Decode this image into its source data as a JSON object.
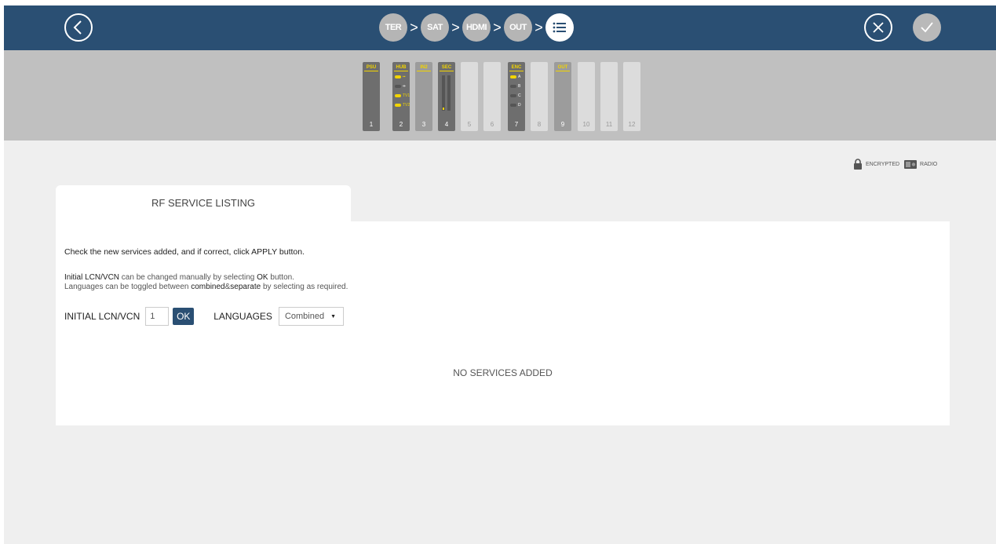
{
  "header": {
    "steps": [
      {
        "label": "TER",
        "active": false
      },
      {
        "label": "SAT",
        "active": false
      },
      {
        "label": "HDMI",
        "active": false
      },
      {
        "label": "OUT",
        "active": false
      },
      {
        "label": "",
        "icon": "list-icon",
        "active": true
      }
    ],
    "step_separator": ">"
  },
  "rack": {
    "slots": [
      {
        "number": "1",
        "tag": "PSU"
      },
      {
        "number": "2",
        "tag": "HUB",
        "ports": [
          "",
          "",
          "TV1",
          "TV2"
        ]
      },
      {
        "number": "3",
        "tag": "IN2"
      },
      {
        "number": "4",
        "tag": "SEC"
      },
      {
        "number": "5",
        "tag": ""
      },
      {
        "number": "6",
        "tag": ""
      },
      {
        "number": "7",
        "tag": "ENC",
        "ports": [
          "A",
          "B",
          "C",
          "D"
        ]
      },
      {
        "number": "8",
        "tag": ""
      },
      {
        "number": "9",
        "tag": "OUT"
      },
      {
        "number": "10",
        "tag": ""
      },
      {
        "number": "11",
        "tag": ""
      },
      {
        "number": "12",
        "tag": ""
      }
    ]
  },
  "legend": {
    "encrypted_label": "ENCRYPTED",
    "radio_label": "RADIO"
  },
  "tab": {
    "label": "RF SERVICE LISTING"
  },
  "panel": {
    "instruction": "Check the new services added, and if correct, click APPLY button.",
    "note1": {
      "prefix": "Initial LCN/VCN",
      "middle": " can be changed manually by selecting ",
      "button_word": "OK",
      "suffix": " button."
    },
    "note2": {
      "prefix": "Languages can be toggled between ",
      "word1": "combined",
      "amp": "&",
      "word2": "separate",
      "suffix": " by selecting as required."
    },
    "lcn_label": "INITIAL LCN/VCN",
    "lcn_value": "1",
    "ok_label": "OK",
    "languages_label": "LANGUAGES",
    "languages_selected": "Combined",
    "empty_message": "NO SERVICES ADDED"
  },
  "colors": {
    "header_bg": "#2a4f73",
    "accent_yellow": "#f2d400",
    "ok_button": "#2a4f73"
  }
}
